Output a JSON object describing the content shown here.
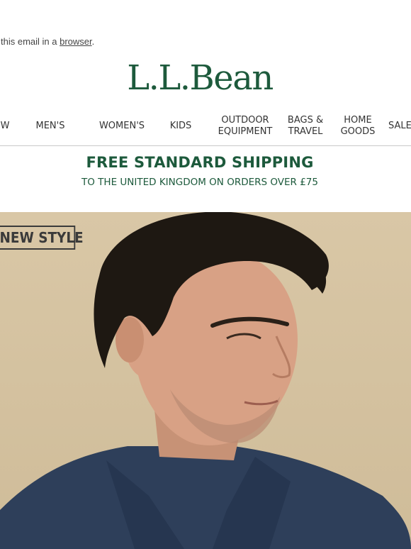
{
  "preheader": {
    "text": "w this email in a ",
    "link": "browser",
    "suffix": "."
  },
  "brand": {
    "logo_text": "L.L.Bean",
    "color": "#1d5a3c"
  },
  "nav": {
    "items": [
      {
        "label": "W"
      },
      {
        "label": "MEN'S"
      },
      {
        "label": "WOMEN'S"
      },
      {
        "label": "KIDS"
      },
      {
        "label": "OUTDOOR\nEQUIPMENT"
      },
      {
        "label": "BAGS &\nTRAVEL"
      },
      {
        "label": "HOME\nGOODS"
      },
      {
        "label": "SALE"
      }
    ]
  },
  "shipping": {
    "title": "FREE STANDARD SHIPPING",
    "subtitle": "TO THE UNITED KINGDOM ON ORDERS OVER £75"
  },
  "hero": {
    "badge": "NEW STYLE",
    "background_color": "#d9c7a6"
  }
}
